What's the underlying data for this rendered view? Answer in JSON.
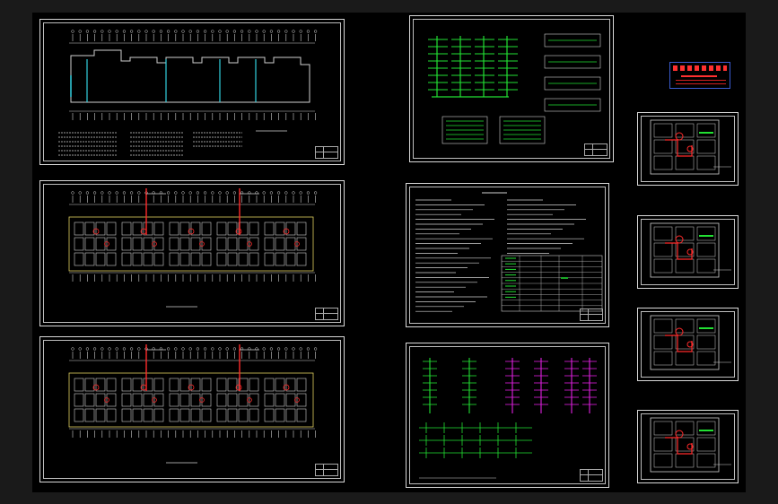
{
  "sheets": [
    {
      "id": "plan-1",
      "kind": "floor-plan",
      "accent": "#33d1e0"
    },
    {
      "id": "plan-2",
      "kind": "floor-plan",
      "accent": "#ff2a2a"
    },
    {
      "id": "plan-3",
      "kind": "floor-plan",
      "accent": "#ff2a2a"
    },
    {
      "id": "riser-green",
      "kind": "riser-diagram",
      "accent": "#22e033"
    },
    {
      "id": "notes",
      "kind": "notes-table",
      "accent": "#22e033"
    },
    {
      "id": "riser-magenta",
      "kind": "riser-diagram",
      "accent": "#e020e0"
    },
    {
      "id": "unit-1",
      "kind": "unit-plan",
      "accent": "#ff2a2a"
    },
    {
      "id": "unit-2",
      "kind": "unit-plan",
      "accent": "#ff2a2a"
    },
    {
      "id": "unit-3",
      "kind": "unit-plan",
      "accent": "#ff2a2a"
    },
    {
      "id": "unit-4",
      "kind": "unit-plan",
      "accent": "#ff2a2a"
    }
  ],
  "colors": {
    "background": "#000000",
    "frame": "#d8d8d8",
    "line": "#cfcfcf",
    "red": "#ff2a2a",
    "green": "#22e033",
    "magenta": "#e020e0",
    "cyan": "#33d1e0",
    "blue": "#3a5bd0"
  },
  "legend_box": {
    "icon": "red-text-block-legend"
  }
}
